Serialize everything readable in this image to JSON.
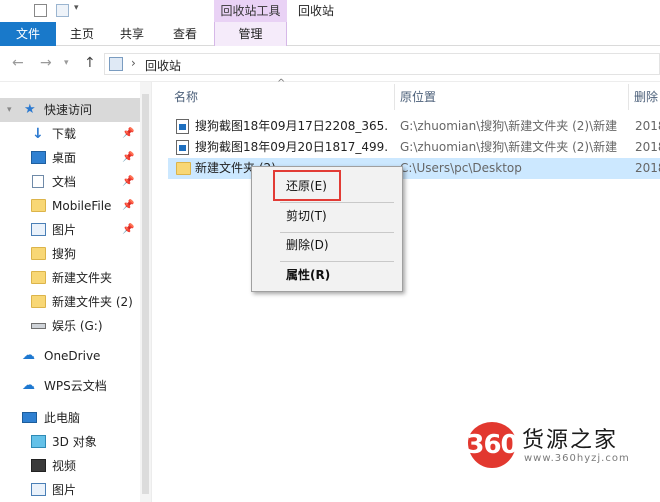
{
  "window": {
    "title": "回收站",
    "context_tab_group": "回收站工具"
  },
  "ribbon": {
    "tabs": [
      "文件",
      "主页",
      "共享",
      "查看",
      "管理"
    ]
  },
  "address": {
    "separator": "›",
    "path": "回收站"
  },
  "sidebar": {
    "items": [
      {
        "label": "快速访问",
        "icon": "star-icon"
      },
      {
        "label": "下载",
        "icon": "download-icon"
      },
      {
        "label": "桌面",
        "icon": "desktop-icon"
      },
      {
        "label": "文档",
        "icon": "document-icon"
      },
      {
        "label": "MobileFile",
        "icon": "folder-icon"
      },
      {
        "label": "图片",
        "icon": "pictures-icon"
      },
      {
        "label": "搜狗",
        "icon": "folder-icon"
      },
      {
        "label": "新建文件夹",
        "icon": "folder-icon"
      },
      {
        "label": "新建文件夹 (2)",
        "icon": "folder-icon"
      },
      {
        "label": "娱乐 (G:)",
        "icon": "drive-icon"
      },
      {
        "label": "OneDrive",
        "icon": "cloud-icon"
      },
      {
        "label": "WPS云文档",
        "icon": "wps-cloud-icon"
      },
      {
        "label": "此电脑",
        "icon": "computer-icon"
      },
      {
        "label": "3D 对象",
        "icon": "3d-objects-icon"
      },
      {
        "label": "视频",
        "icon": "video-icon"
      },
      {
        "label": "图片",
        "icon": "pictures-icon"
      }
    ]
  },
  "columns": {
    "name": "名称",
    "location": "原位置",
    "deleted": "删除"
  },
  "files": [
    {
      "name": "搜狗截图18年09月17日2208_365.",
      "location": "G:\\zhuomian\\搜狗\\新建文件夹 (2)\\新建",
      "deleted": "2018"
    },
    {
      "name": "搜狗截图18年09月20日1817_499.",
      "location": "G:\\zhuomian\\搜狗\\新建文件夹 (2)\\新建",
      "deleted": "2018"
    },
    {
      "name": "新建文件夹 (2)",
      "location": "C:\\Users\\pc\\Desktop",
      "deleted": "2018"
    }
  ],
  "context_menu": {
    "restore": "还原(E)",
    "cut": "剪切(T)",
    "delete": "删除(D)",
    "properties": "属性(R)"
  },
  "watermark": {
    "logo": "360",
    "brand": "货源之家",
    "url": "www.360hyzj.com"
  },
  "colors": {
    "file_tab": "#1979ca",
    "context_tab": "#e9d2f5",
    "selection": "#cce8ff",
    "highlight_box": "#e23b35",
    "logo_red": "#e2382f"
  }
}
